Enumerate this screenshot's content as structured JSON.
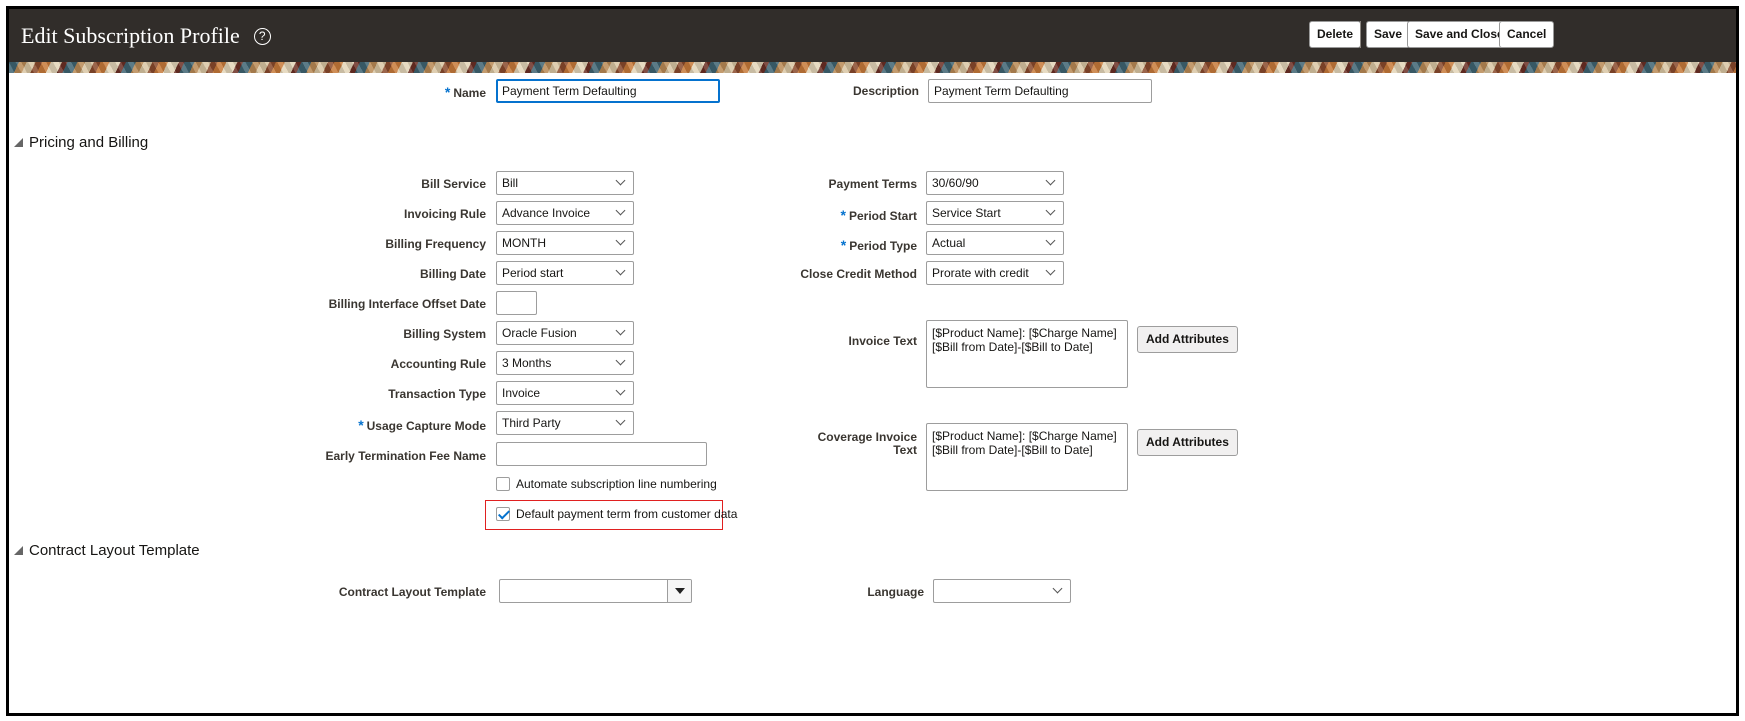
{
  "header": {
    "title": "Edit Subscription Profile",
    "help_icon": "?",
    "buttons": {
      "delete": "Delete",
      "save": "Save",
      "save_and_close": "Save and Close",
      "cancel": "Cancel"
    }
  },
  "top_fields": {
    "name_label": "Name",
    "name_value": "Payment Term Defaulting",
    "description_label": "Description",
    "description_value": "Payment Term Defaulting"
  },
  "pricing_section": {
    "title": "Pricing and Billing",
    "left_fields": [
      {
        "label": "Bill Service",
        "value": "Bill",
        "required": false
      },
      {
        "label": "Invoicing Rule",
        "value": "Advance Invoice",
        "required": false
      },
      {
        "label": "Billing Frequency",
        "value": "MONTH",
        "required": false
      },
      {
        "label": "Billing Date",
        "value": "Period start",
        "required": false
      },
      {
        "label": "Billing Interface Offset Date",
        "value": "",
        "required": false
      },
      {
        "label": "Billing System",
        "value": "Oracle Fusion",
        "required": false
      },
      {
        "label": "Accounting Rule",
        "value": "3 Months",
        "required": false
      },
      {
        "label": "Transaction Type",
        "value": "Invoice",
        "required": false
      },
      {
        "label": "Usage Capture Mode",
        "value": "Third Party",
        "required": true
      },
      {
        "label": "Early Termination Fee Name",
        "value": "",
        "required": false
      }
    ],
    "right_fields": [
      {
        "label": "Payment Terms",
        "value": "30/60/90",
        "required": false
      },
      {
        "label": "Period Start",
        "value": "Service Start",
        "required": true
      },
      {
        "label": "Period Type",
        "value": "Actual",
        "required": true
      },
      {
        "label": "Close Credit Method",
        "value": "Prorate with credit",
        "required": false
      }
    ],
    "invoice_text_label": "Invoice Text",
    "invoice_text_line1": "[$Product Name]: [$Charge Name]",
    "invoice_text_line2": "[$Bill from Date]-[$Bill to Date]",
    "coverage_label_line1": "Coverage Invoice",
    "coverage_label_line2": "Text",
    "coverage_text_line1": "[$Product Name]: [$Charge Name]",
    "coverage_text_line2": "[$Bill from Date]-[$Bill to Date]",
    "add_attributes_label": "Add Attributes",
    "checkbox_auto_numbering": "Automate subscription line numbering",
    "checkbox_auto_numbering_checked": false,
    "checkbox_default_payment": "Default payment term from customer data",
    "checkbox_default_payment_checked": true
  },
  "layout_section": {
    "title": "Contract Layout Template",
    "template_label": "Contract Layout Template",
    "template_value": "",
    "language_label": "Language",
    "language_value": ""
  },
  "colors": {
    "header_bg": "#312d2a",
    "required_star": "#0572ce",
    "highlight_box": "#e02020",
    "checkbox_check": "#0572ce"
  }
}
